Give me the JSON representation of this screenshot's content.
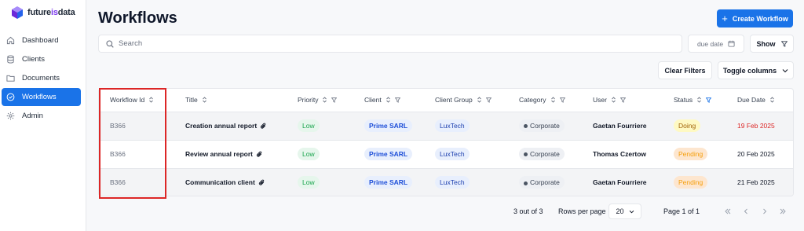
{
  "brand": {
    "name_part1": "future",
    "name_part2": "is",
    "name_part3": "data"
  },
  "sidebar": {
    "items": [
      {
        "label": "Dashboard",
        "icon": "home-icon",
        "active": false
      },
      {
        "label": "Clients",
        "icon": "database-icon",
        "active": false
      },
      {
        "label": "Documents",
        "icon": "folder-icon",
        "active": false
      },
      {
        "label": "Workflows",
        "icon": "check-circle-icon",
        "active": true
      },
      {
        "label": "Admin",
        "icon": "gear-icon",
        "active": false
      }
    ]
  },
  "header": {
    "title": "Workflows",
    "create_label": "Create Workflow"
  },
  "filters": {
    "search_placeholder": "Search",
    "due_date_label": "due date",
    "show_label": "Show",
    "clear_label": "Clear Filters",
    "toggle_label": "Toggle columns"
  },
  "table": {
    "columns": [
      "Workflow Id",
      "Title",
      "Priority",
      "Client",
      "Client Group",
      "Category",
      "User",
      "Status",
      "Due Date"
    ],
    "rows": [
      {
        "id": "B366",
        "title": "Creation annual report",
        "priority": "Low",
        "client": "Prime SARL",
        "group": "LuxTech",
        "category": "Corporate",
        "user": "Gaetan Fourriere",
        "status": "Doing",
        "due": "19 Feb 2025"
      },
      {
        "id": "B366",
        "title": "Review annual report",
        "priority": "Low",
        "client": "Prime SARL",
        "group": "LuxTech",
        "category": "Corporate",
        "user": "Thomas Czertow",
        "status": "Pending",
        "due": "20 Feb 2025"
      },
      {
        "id": "B366",
        "title": "Communication client",
        "priority": "Low",
        "client": "Prime SARL",
        "group": "LuxTech",
        "category": "Corporate",
        "user": "Gaetan Fourriere",
        "status": "Pending",
        "due": "21 Feb 2025"
      }
    ]
  },
  "pagination": {
    "count": "3 out of 3",
    "rows_per_page_label": "Rows per page",
    "rows_per_page_value": "20",
    "page_info": "Page 1 of 1"
  },
  "colors": {
    "accent": "#1a73e8",
    "highlight": "#dc2626"
  }
}
